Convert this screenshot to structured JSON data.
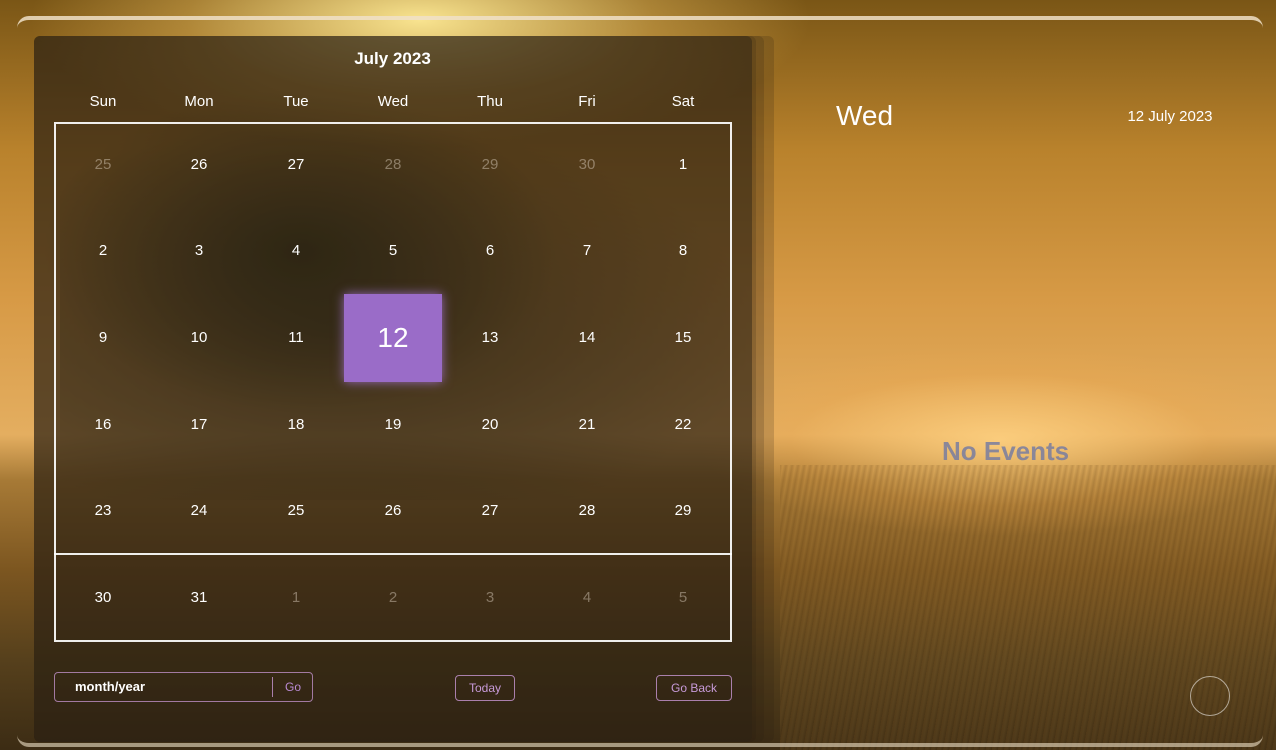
{
  "calendar": {
    "month_title": "July 2023",
    "weekdays": [
      "Sun",
      "Mon",
      "Tue",
      "Wed",
      "Thu",
      "Fri",
      "Sat"
    ],
    "weeks": [
      [
        "25",
        "26",
        "27",
        "28",
        "29",
        "30",
        "1"
      ],
      [
        "2",
        "3",
        "4",
        "5",
        "6",
        "7",
        "8"
      ],
      [
        "9",
        "10",
        "11",
        "12",
        "13",
        "14",
        "15"
      ],
      [
        "16",
        "17",
        "18",
        "19",
        "20",
        "21",
        "22"
      ],
      [
        "23",
        "24",
        "25",
        "26",
        "27",
        "28",
        "29"
      ],
      [
        "30",
        "31",
        "1",
        "2",
        "3",
        "4",
        "5"
      ]
    ],
    "selected_day": "12"
  },
  "controls": {
    "month_input_value": "month/year",
    "go_label": "Go",
    "today_label": "Today",
    "go_back_label": "Go Back"
  },
  "events_panel": {
    "day_name": "Wed",
    "full_date": "12 July 2023",
    "empty_message": "No Events"
  },
  "colors": {
    "selected_accent": "#9a6cc8",
    "button_text": "#c79ad8"
  }
}
